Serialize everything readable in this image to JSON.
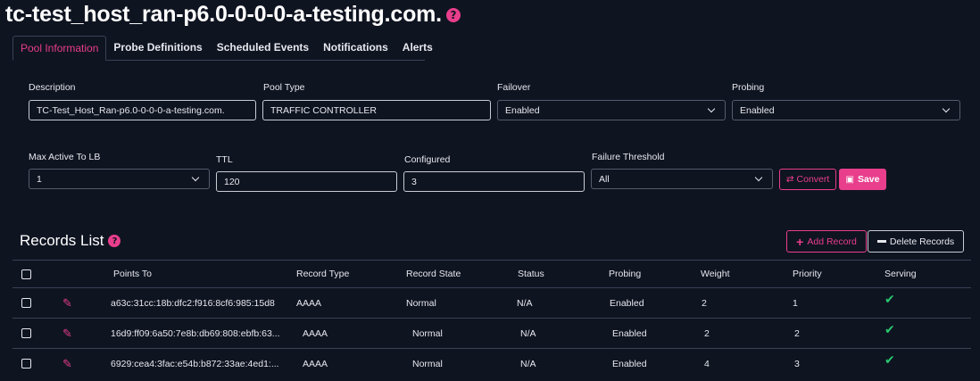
{
  "page": {
    "title": "tc-test_host_ran-p6.0-0-0-0-a-testing.com.",
    "help_glyph": "?"
  },
  "tabs": [
    {
      "label": "Pool Information"
    },
    {
      "label": "Probe Definitions"
    },
    {
      "label": "Scheduled Events"
    },
    {
      "label": "Notifications"
    },
    {
      "label": "Alerts"
    }
  ],
  "form": {
    "description": {
      "label": "Description",
      "value": "TC-Test_Host_Ran-p6.0-0-0-0-a-testing.com."
    },
    "pool_type": {
      "label": "Pool Type",
      "value": "TRAFFIC CONTROLLER"
    },
    "failover": {
      "label": "Failover",
      "value": "Enabled"
    },
    "probing": {
      "label": "Probing",
      "value": "Enabled"
    },
    "max_active": {
      "label": "Max Active To LB",
      "value": "1"
    },
    "ttl": {
      "label": "TTL",
      "value": "120"
    },
    "configured": {
      "label": "Configured",
      "value": "3"
    },
    "failure_threshold": {
      "label": "Failure Threshold",
      "value": "All"
    },
    "convert_label": "Convert",
    "save_label": "Save"
  },
  "records": {
    "title": "Records List",
    "add_label": "Add Record",
    "delete_label": "Delete Records",
    "columns": [
      "Points To",
      "Record Type",
      "Record State",
      "Status",
      "Probing",
      "Weight",
      "Priority",
      "Serving"
    ],
    "rows": [
      {
        "points_to": "a63c:31cc:18b:dfc2:f916:8cf6:985:15d8",
        "type": "AAAA",
        "state": "Normal",
        "status": "N/A",
        "probing": "Enabled",
        "weight": "2",
        "priority": "1"
      },
      {
        "points_to": "16d9:ff09:6a50:7e8b:db69:808:ebfb:63...",
        "type": "AAAA",
        "state": "Normal",
        "status": "N/A",
        "probing": "Enabled",
        "weight": "2",
        "priority": "2"
      },
      {
        "points_to": "6929:cea4:3fac:e54b:b872:33ae:4ed1:...",
        "type": "AAAA",
        "state": "Normal",
        "status": "N/A",
        "probing": "Enabled",
        "weight": "4",
        "priority": "3"
      }
    ]
  },
  "colors": {
    "background": "#0f1421",
    "accent": "#e83e8c",
    "success": "#28c76f"
  }
}
